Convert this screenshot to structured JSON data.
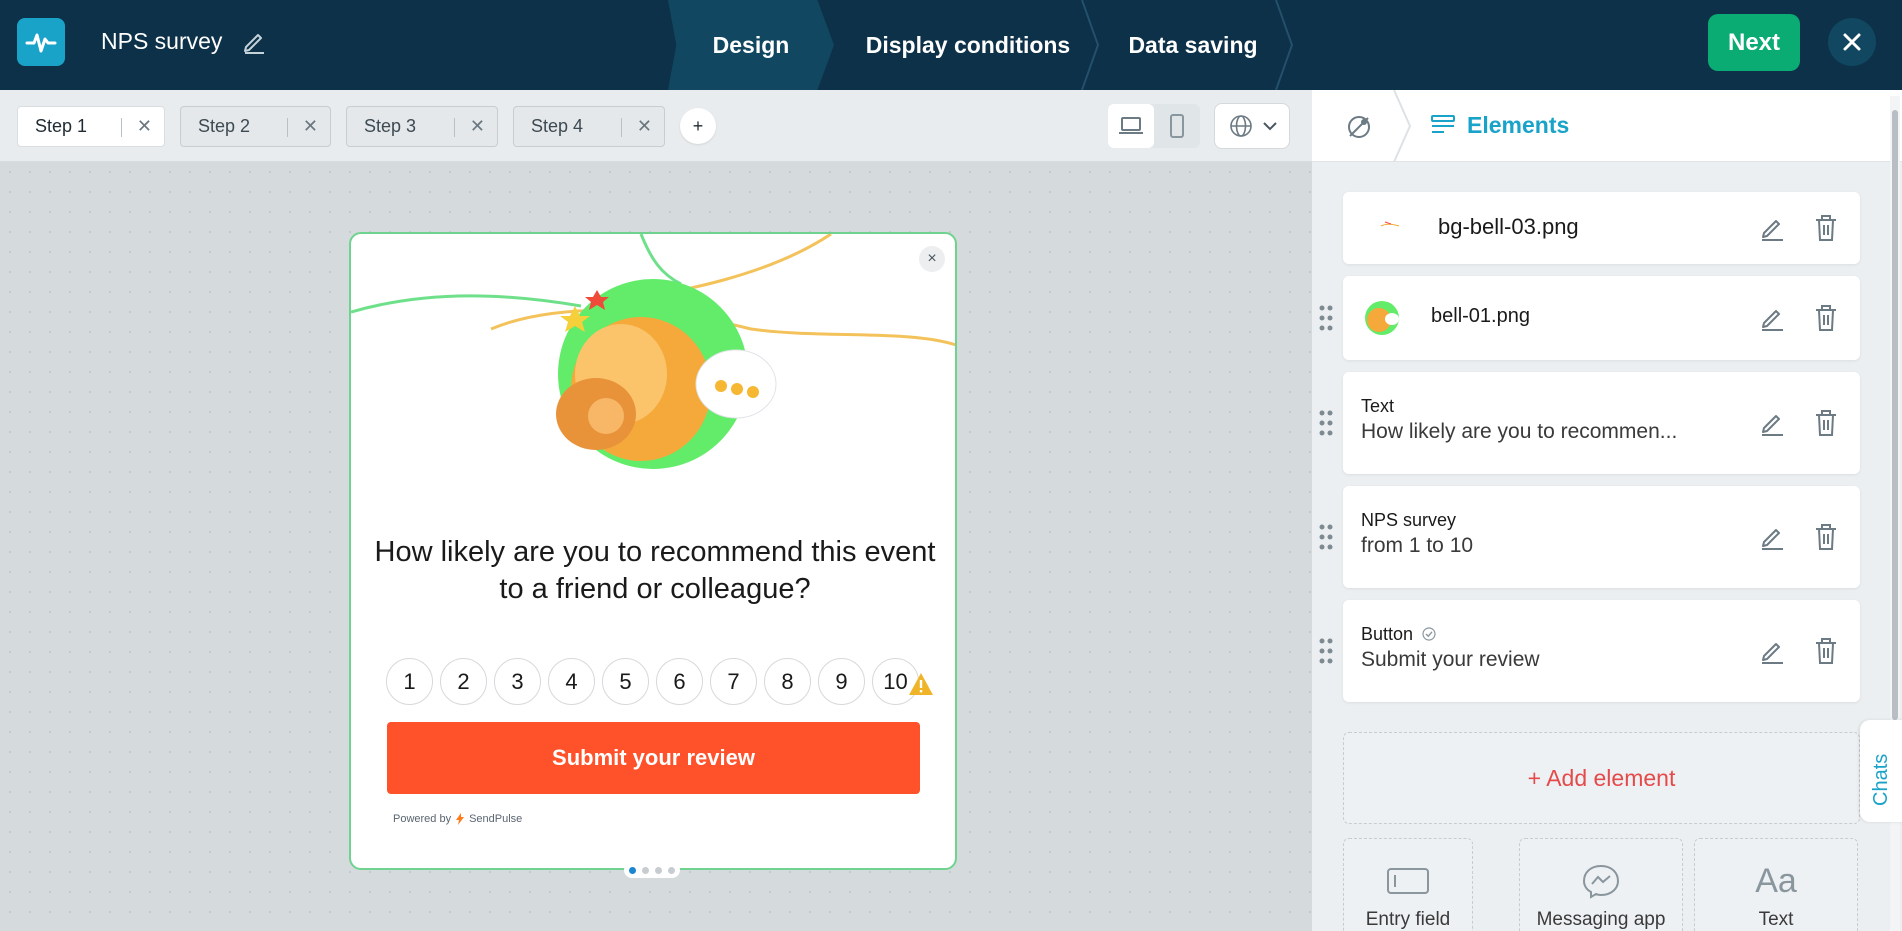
{
  "header": {
    "survey_title": "NPS survey",
    "nav": [
      "Design",
      "Display conditions",
      "Data saving"
    ],
    "next_label": "Next"
  },
  "canvas_toolbar": {
    "steps": [
      {
        "label": "Step 1",
        "active": true
      },
      {
        "label": "Step 2",
        "active": false
      },
      {
        "label": "Step 3",
        "active": false
      },
      {
        "label": "Step 4",
        "active": false
      }
    ],
    "add_step_label": "+"
  },
  "popup": {
    "question": "How likely are you to recommend this event to a friend or colleague?",
    "scale": [
      "1",
      "2",
      "3",
      "4",
      "5",
      "6",
      "7",
      "8",
      "9",
      "10"
    ],
    "submit_label": "Submit your review",
    "powered_by": "Powered by",
    "brand": "SendPulse",
    "close_label": "×"
  },
  "panel": {
    "title": "Elements",
    "elements": [
      {
        "name": "bg-bell-03.png"
      },
      {
        "name": "bell-01.png"
      },
      {
        "kind": "Text",
        "value": "How likely are you to recommen..."
      },
      {
        "kind": "NPS survey",
        "value": "from 1 to 10"
      },
      {
        "kind": "Button",
        "value": "Submit your review"
      }
    ],
    "add_element_label": "+ Add element",
    "tiles": [
      "Entry field",
      "Messaging app",
      "Text"
    ],
    "text_tile_glyph": "Aa"
  },
  "chats_label": "Chats",
  "colors": {
    "header_bg": "#0c3148",
    "accent": "#1aa3c9",
    "next_green": "#0bab74",
    "submit_orange": "#ff512a",
    "add_element_red": "#e54a4a"
  }
}
